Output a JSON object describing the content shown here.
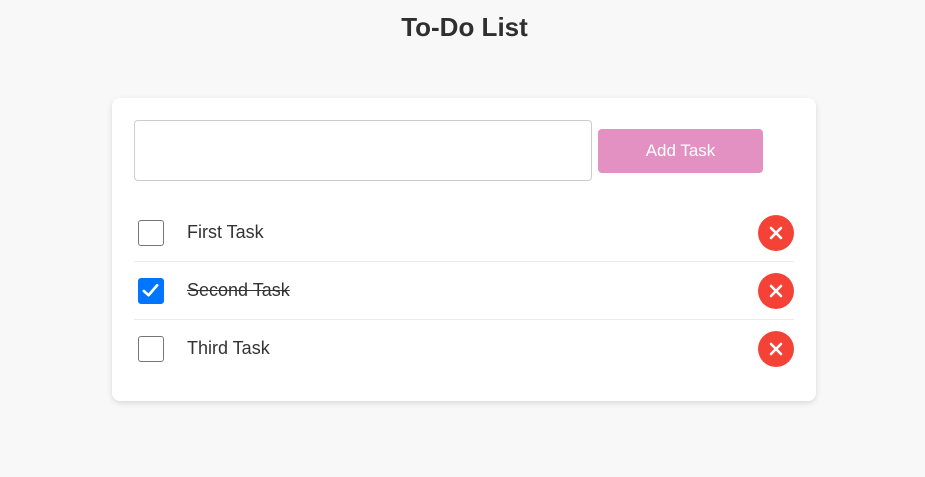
{
  "title": "To-Do List",
  "input": {
    "value": "",
    "placeholder": ""
  },
  "add_button_label": "Add Task",
  "tasks": [
    {
      "text": "First Task",
      "completed": false
    },
    {
      "text": "Second Task",
      "completed": true
    },
    {
      "text": "Third Task",
      "completed": false
    }
  ],
  "colors": {
    "background": "#f8f8f8",
    "card": "#ffffff",
    "add_button": "#e291c2",
    "delete_button": "#f44336",
    "checkbox_checked": "#0075ff"
  },
  "icons": {
    "checkbox_mark": "checkmark-icon",
    "delete": "close-icon"
  }
}
